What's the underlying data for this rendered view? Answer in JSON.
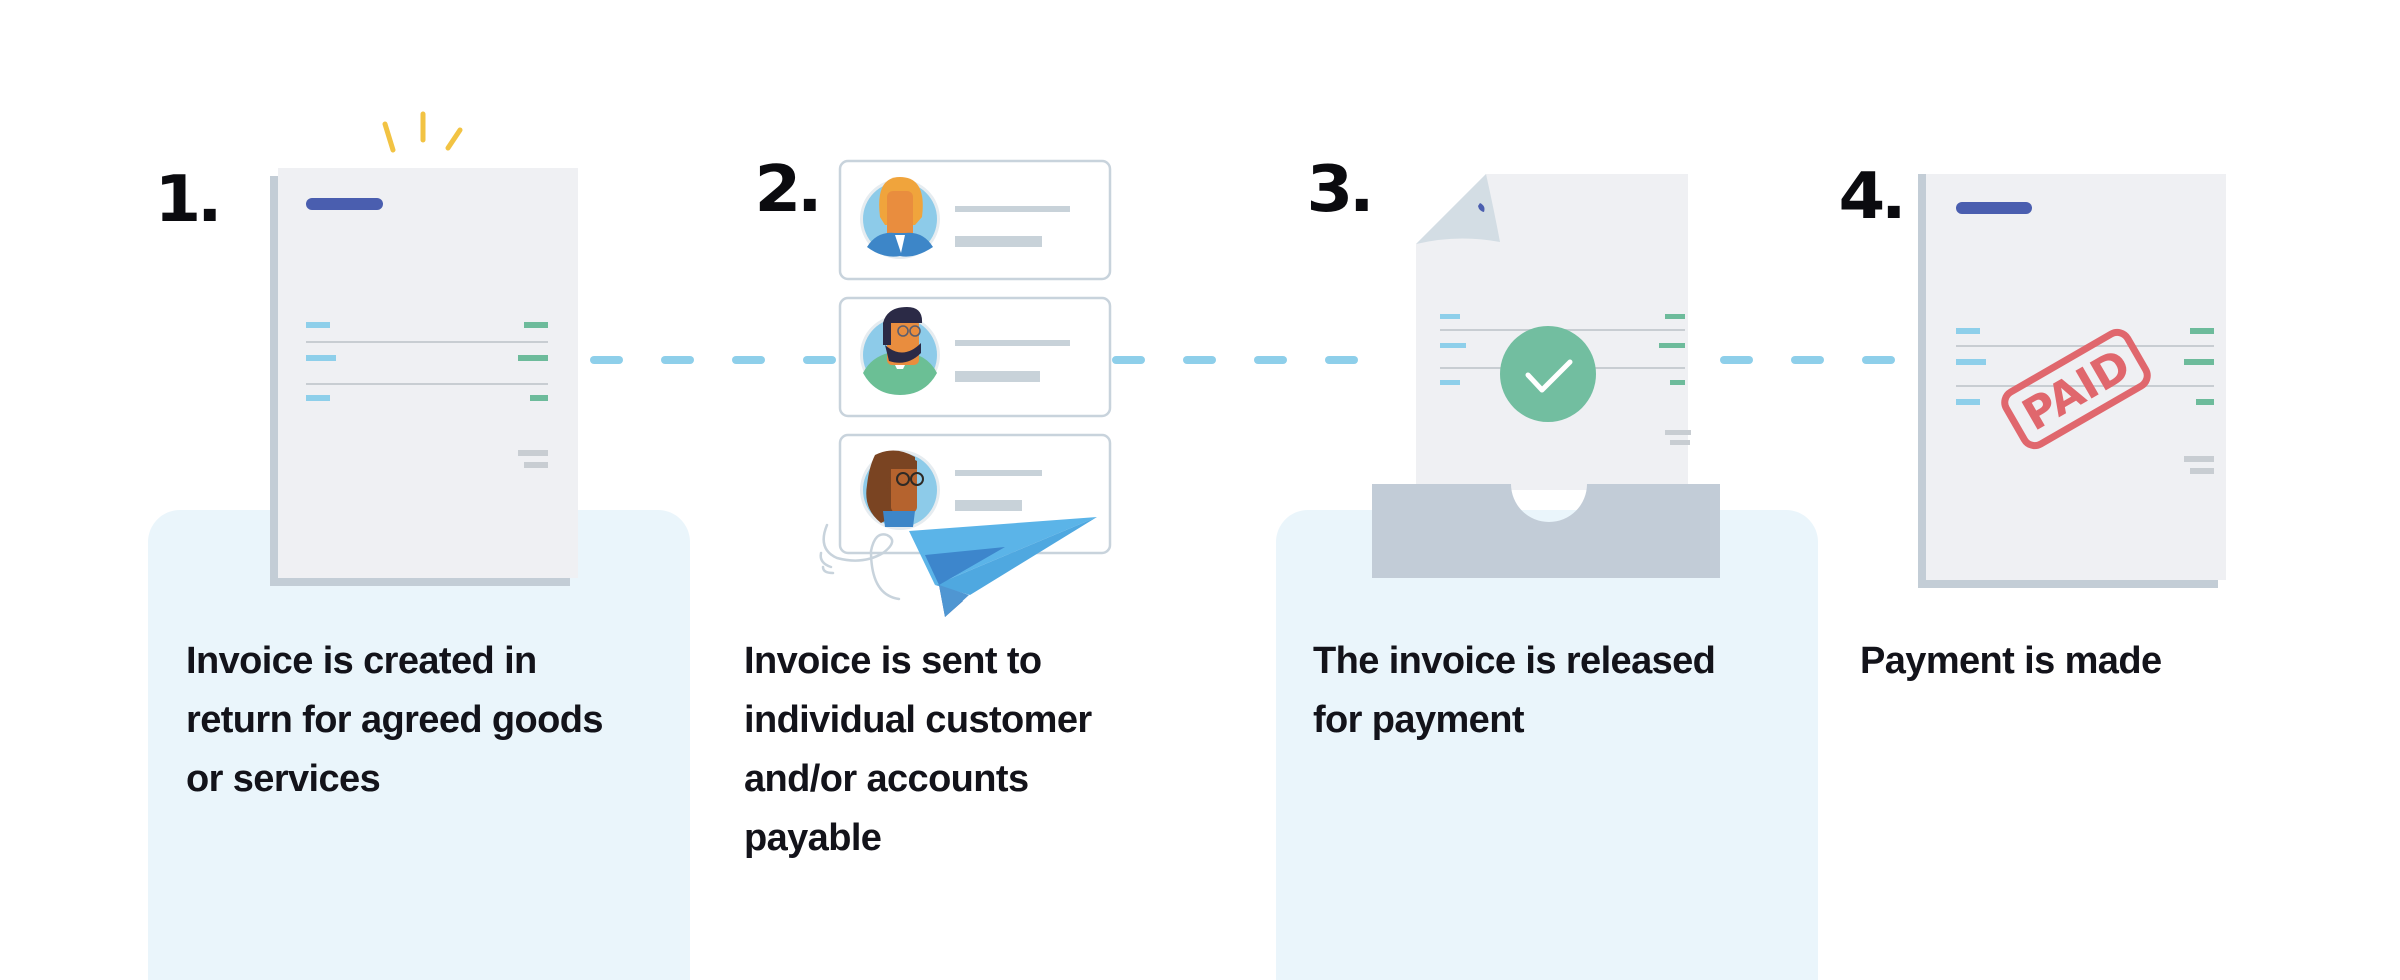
{
  "colors": {
    "panel_bg": "#eaf5fb",
    "document": "#eff0f3",
    "document_shadow": "#c3cdd6",
    "header_bar": "#4a5eaf",
    "line_blue": "#8ecfea",
    "line_green": "#6dbb9b",
    "check_circle": "#72bea0",
    "paid_stamp": "#e0676d",
    "sparkle": "#f2c343",
    "connector": "#8ecfea",
    "paper_plane": "#4fafe6"
  },
  "steps": [
    {
      "number": "1.",
      "text_lines": [
        "Invoice is created in",
        "return for agreed goods",
        "or services"
      ],
      "illustration": "new-invoice-document"
    },
    {
      "number": "2.",
      "text_lines": [
        "Invoice is sent to",
        "individual customer",
        "and/or accounts",
        "payable"
      ],
      "illustration": "recipient-cards-with-paper-plane"
    },
    {
      "number": "3.",
      "text_lines": [
        "The invoice is released",
        "for payment"
      ],
      "illustration": "approved-invoice-in-tray"
    },
    {
      "number": "4.",
      "text_lines": [
        "Payment is made"
      ],
      "illustration": "paid-invoice-document"
    }
  ],
  "stamp": {
    "label": "PAID"
  }
}
